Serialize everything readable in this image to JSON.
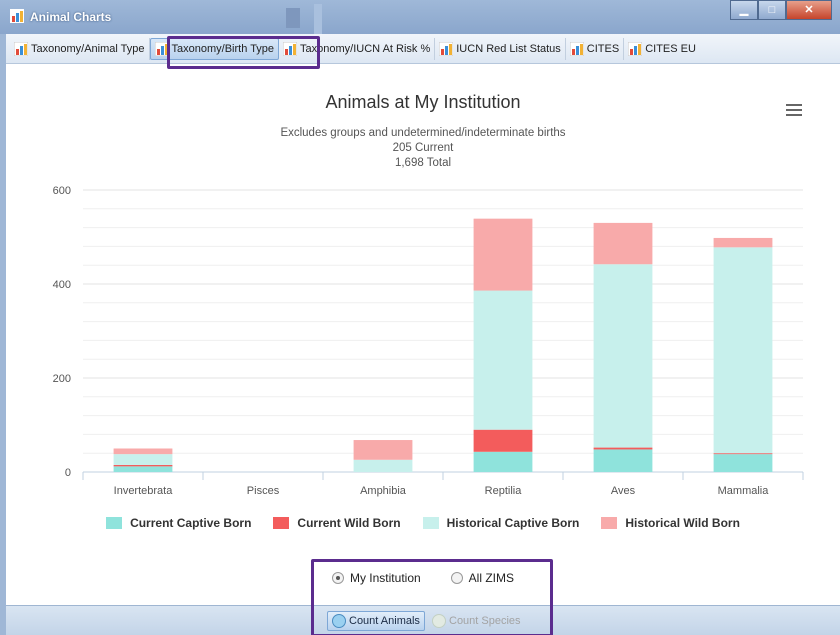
{
  "window": {
    "title": "Animal Charts"
  },
  "tabs": [
    {
      "label": "Taxonomy/Animal Type"
    },
    {
      "label": "Taxonomy/Birth Type"
    },
    {
      "label": "Taxonomy/IUCN At Risk %"
    },
    {
      "label": "IUCN Red List Status"
    },
    {
      "label": "CITES"
    },
    {
      "label": "CITES EU"
    }
  ],
  "active_tab": "Taxonomy/Birth Type",
  "chart": {
    "title": "Animals at My Institution",
    "subtitle1": "Excludes groups and undetermined/indeterminate births",
    "subtitle2": "205 Current",
    "subtitle3": "1,698 Total"
  },
  "chart_data": {
    "type": "bar",
    "stacked": true,
    "categories": [
      "Invertebrata",
      "Pisces",
      "Amphibia",
      "Reptilia",
      "Aves",
      "Mammalia"
    ],
    "series": [
      {
        "name": "Current Captive Born",
        "color": "#8fe3dc",
        "values": [
          12,
          0,
          0,
          43,
          48,
          38
        ]
      },
      {
        "name": "Current Wild Born",
        "color": "#f35c5c",
        "values": [
          3,
          0,
          0,
          47,
          4,
          2
        ]
      },
      {
        "name": "Historical Captive Born",
        "color": "#c7f0ec",
        "values": [
          23,
          0,
          26,
          296,
          390,
          438
        ]
      },
      {
        "name": "Historical Wild Born",
        "color": "#f8aaaa",
        "values": [
          12,
          0,
          42,
          153,
          88,
          20
        ]
      }
    ],
    "yticks": [
      0,
      200,
      400,
      600
    ],
    "ylim": [
      0,
      600
    ],
    "grid": true,
    "legend": "bottom"
  },
  "controls": {
    "scope_options": [
      {
        "label": "My Institution",
        "selected": true
      },
      {
        "label": "All ZIMS",
        "selected": false
      }
    ],
    "count_animals_label": "Count Animals",
    "count_species_label": "Count Species"
  },
  "colors": {
    "accent_highlight": "#5b2c8e",
    "window_blue": "#9fb7d6"
  }
}
